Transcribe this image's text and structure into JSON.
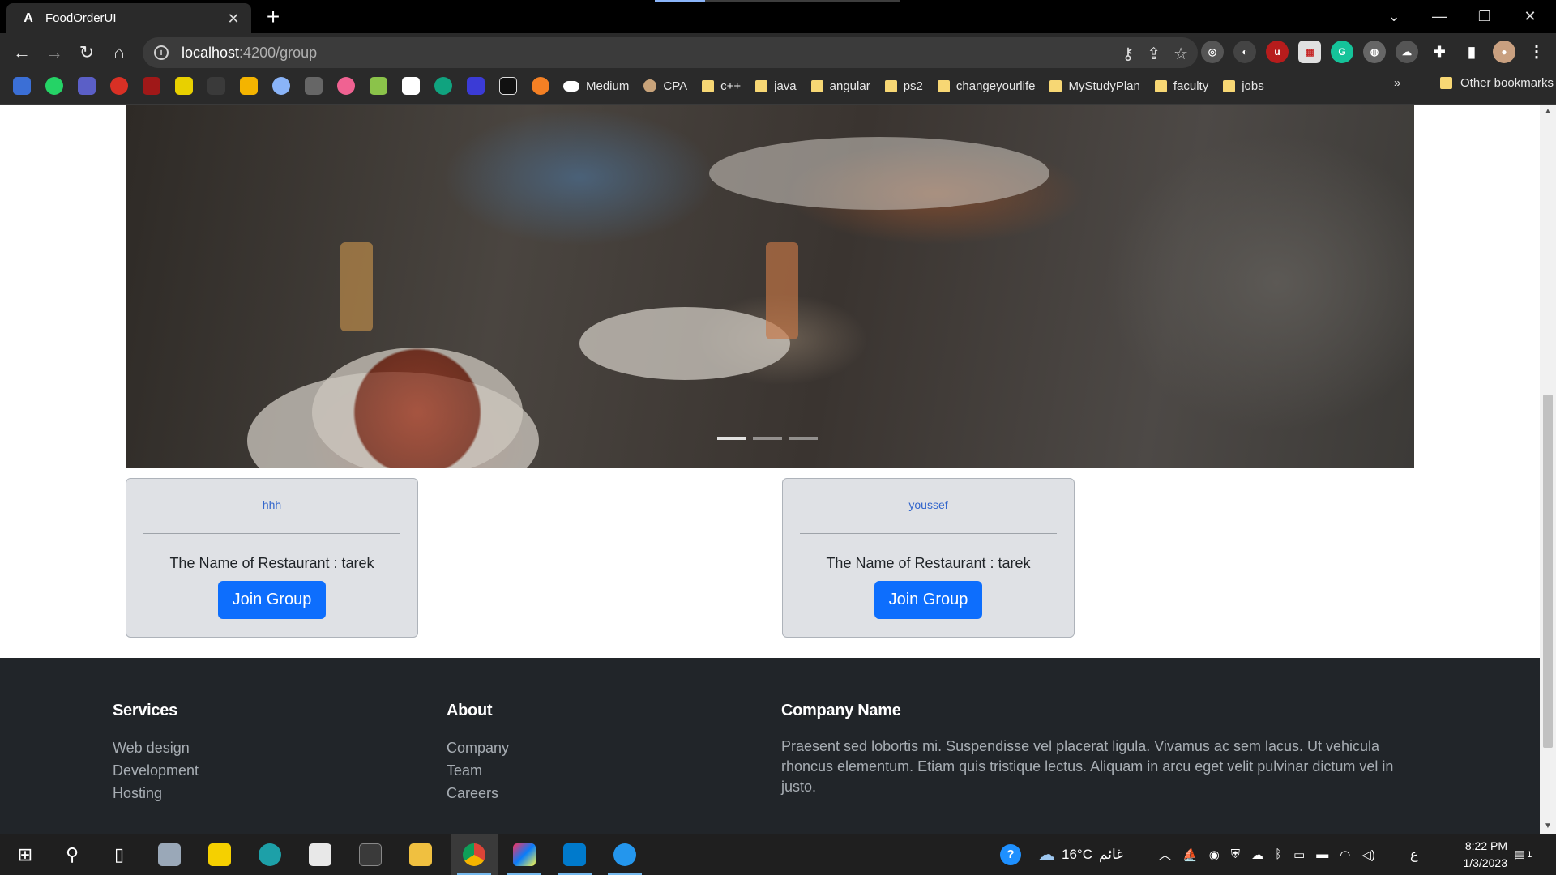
{
  "browser": {
    "tab_title": "FoodOrderUI",
    "tab_icon": "A",
    "new_tab": "+",
    "url_host": "localhost",
    "url_path": ":4200/group",
    "bookmarks": [
      {
        "label": "Medium",
        "icon": "medium-icon"
      },
      {
        "label": "CPA",
        "icon": "cpa-icon"
      },
      {
        "label": "c++",
        "icon": "folder-icon"
      },
      {
        "label": "java",
        "icon": "folder-icon"
      },
      {
        "label": "angular",
        "icon": "folder-icon"
      },
      {
        "label": "ps2",
        "icon": "folder-icon"
      },
      {
        "label": "changeyourlife",
        "icon": "folder-icon"
      },
      {
        "label": "MyStudyPlan",
        "icon": "folder-icon"
      },
      {
        "label": "faculty",
        "icon": "folder-icon"
      },
      {
        "label": "jobs",
        "icon": "folder-icon"
      }
    ],
    "bookmarks_more": "»",
    "other_bookmarks": "Other bookmarks"
  },
  "groups": [
    {
      "name": "hhh",
      "restaurant_text": "The Name of Restaurant : tarek",
      "button_label": "Join Group"
    },
    {
      "name": "youssef",
      "restaurant_text": "The Name of Restaurant : tarek",
      "button_label": "Join Group"
    }
  ],
  "footer": {
    "services": {
      "title": "Services",
      "links": [
        "Web design",
        "Development",
        "Hosting"
      ]
    },
    "about": {
      "title": "About",
      "links": [
        "Company",
        "Team",
        "Careers"
      ]
    },
    "company": {
      "title": "Company Name",
      "text": "Praesent sed lobortis mi. Suspendisse vel placerat ligula. Vivamus ac sem lacus. Ut vehicula rhoncus elementum. Etiam quis tristique lectus. Aliquam in arcu eget velit pulvinar dictum vel in justo."
    }
  },
  "taskbar": {
    "temperature": "16°C",
    "weather_text": "غائم",
    "language": "ع",
    "time": "8:22 PM",
    "date": "1/3/2023",
    "notification_count": "1"
  },
  "colors": {
    "primary_button": "#0d6efd",
    "group_name": "#3366cc",
    "card_bg": "#dfe1e5",
    "footer_bg": "#212529"
  }
}
